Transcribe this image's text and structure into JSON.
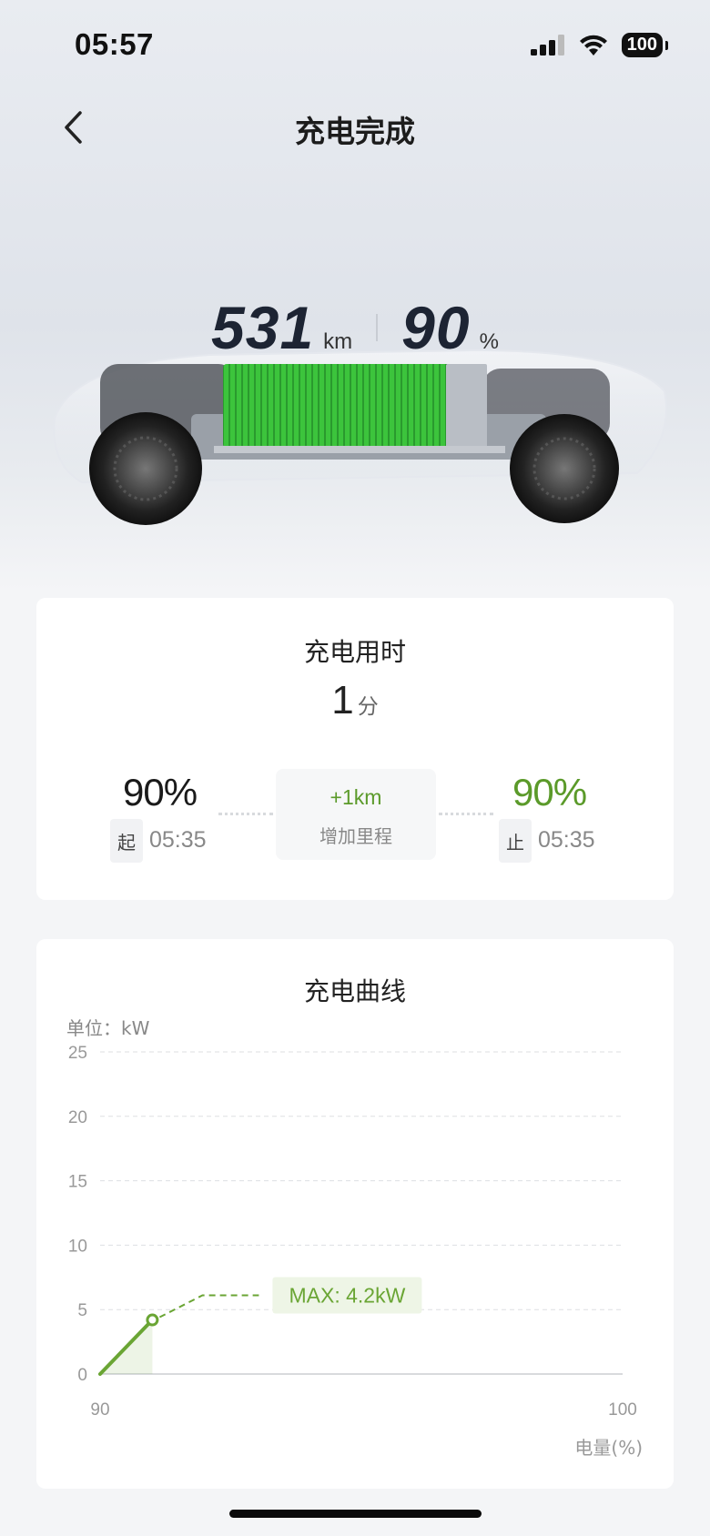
{
  "status": {
    "time": "05:57",
    "battery": "100"
  },
  "header": {
    "title": "充电完成"
  },
  "hero": {
    "range_value": "531",
    "range_unit": "km",
    "soc_value": "90",
    "soc_unit": "%"
  },
  "duration_card": {
    "title": "充电用时",
    "value": "1",
    "unit": "分",
    "start_pct": "90%",
    "start_tag": "起",
    "start_time": "05:35",
    "end_pct": "90%",
    "end_tag": "止",
    "end_time": "05:35",
    "added_range": "+1km",
    "added_range_label": "增加里程"
  },
  "curve_card": {
    "title": "充电曲线",
    "unit_label": "单位：kW",
    "x_axis_label": "电量(%)",
    "max_label": "MAX: 4.2kW"
  },
  "colors": {
    "accent_green": "#6aa534",
    "end_green": "#5b9a2a",
    "battery_green": "#3cc43c"
  },
  "chart_data": {
    "type": "line",
    "x": [
      90,
      91
    ],
    "y": [
      0,
      4.2
    ],
    "xlim": [
      90,
      100
    ],
    "ylim": [
      0,
      25
    ],
    "yticks": [
      0,
      5,
      10,
      15,
      20,
      25
    ],
    "xticks": [
      90,
      100
    ],
    "ylabel": "单位：kW",
    "xlabel": "电量(%)",
    "annotation": "MAX: 4.2kW",
    "grid": true
  }
}
